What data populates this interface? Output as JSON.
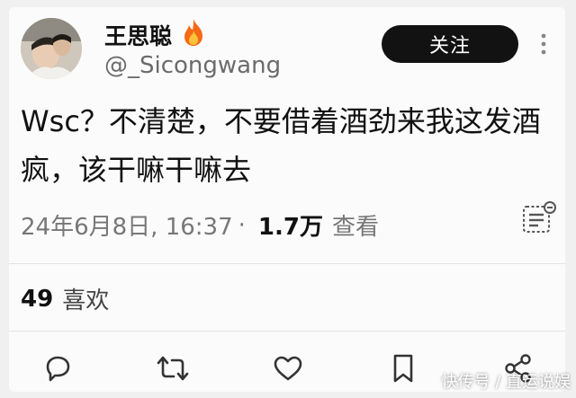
{
  "profile": {
    "display_name": "王思聪",
    "name_emoji": "🔥",
    "handle": "@_Sicongwang",
    "follow_label": "关注",
    "avatar_icon": "avatar-photo"
  },
  "tweet": {
    "text": "Wsc？不清楚，不要借着酒劲来我这发酒疯，该干嘛干嘛去"
  },
  "meta": {
    "date_time": "24年6月8日, 16:37",
    "separator": "·",
    "views_count": "1.7万",
    "views_label": "查看"
  },
  "likes": {
    "count": "49",
    "label": "喜欢"
  },
  "actions": [
    "reply-icon",
    "retweet-icon",
    "like-icon",
    "bookmark-icon",
    "share-icon"
  ],
  "watermark": "快传号 / 直运说娱",
  "colors": {
    "follow_bg": "#121212",
    "muted": "#777777"
  }
}
